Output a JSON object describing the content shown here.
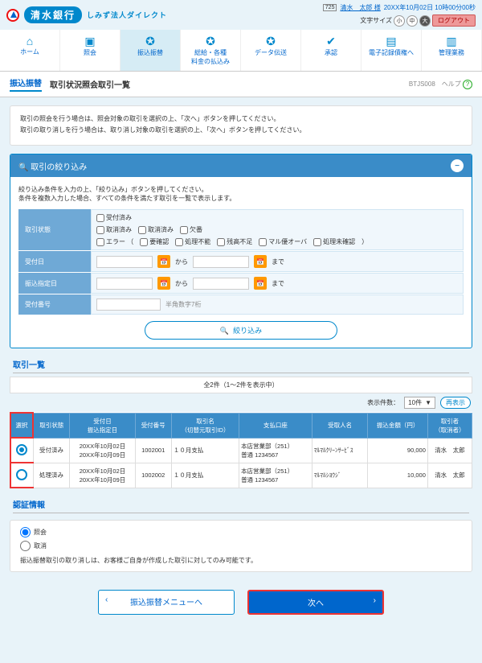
{
  "header": {
    "bank_name": "清水銀行",
    "subtitle": "しみず法人ダイレクト",
    "user_prefix": "725",
    "user_name": "清水　太郎 様",
    "datetime": "20XX年10月02日 10時00分00秒",
    "font_label": "文字サイズ",
    "font_small": "小",
    "font_med": "中",
    "font_large": "大",
    "logout": "ログアウト"
  },
  "nav": [
    {
      "icon": "⌂",
      "label": "ホーム"
    },
    {
      "icon": "▣",
      "label": "照会"
    },
    {
      "icon": "✪",
      "label": "振込振替"
    },
    {
      "icon": "✪",
      "label": "総給・各種\n料金の払込み"
    },
    {
      "icon": "✪",
      "label": "データ伝送"
    },
    {
      "icon": "✔",
      "label": "承認"
    },
    {
      "icon": "▤",
      "label": "電子記録債権へ"
    },
    {
      "icon": "▥",
      "label": "管理業務"
    }
  ],
  "crumb": {
    "category": "振込振替",
    "title": "取引状況照会取引一覧",
    "code": "BTJS008",
    "help": "ヘルプ"
  },
  "desc": {
    "l1": "取引の照会を行う場合は、照会対象の取引を選択の上、「次へ」ボタンを押してください。",
    "l2": "取引の取り消しを行う場合は、取り消し対象の取引を選択の上、「次へ」ボタンを押してください。"
  },
  "filter": {
    "title": "取引の絞り込み",
    "note1": "絞り込み条件を入力の上、「絞り込み」ボタンを押してください。",
    "note2": "条件を複数入力した場合、すべての条件を満たす取引を一覧で表示します。",
    "status_label": "取引状態",
    "statuses_row1": [
      "受付済み"
    ],
    "statuses_row2": [
      "取消済み",
      "取消済み",
      "欠番"
    ],
    "statuses_row3_pre": "エラー （",
    "statuses_row3": [
      "要確認",
      "処理不能",
      "残高不足",
      "マル優オーバ",
      "処理未確認"
    ],
    "statuses_row3_post": "）",
    "recv_date_label": "受付日",
    "send_date_label": "振込指定日",
    "from": "から",
    "to": "まで",
    "recv_no_label": "受付番号",
    "recv_no_hint": "半角数字7桁",
    "filter_btn": "絞り込み",
    "search_icon": "🔍"
  },
  "list": {
    "title": "取引一覧",
    "count_text": "全2件（1～2件を表示中）",
    "per_page_label": "表示件数：",
    "per_page_value": "10件",
    "refresh": "再表示",
    "cols": {
      "select": "選択",
      "status": "取引状態",
      "dates": "受付日\n振込指定日",
      "recv_no": "受付番号",
      "deal": "取引名\n（切替元取引ID）",
      "account": "支払口座",
      "payee": "受取人名",
      "amount": "振込金額（円）",
      "operator": "取引者\n（取消者）"
    },
    "rows": [
      {
        "selected": true,
        "status": "受付済み",
        "date1": "20XX年10月02日",
        "date2": "20XX年10月09日",
        "recv_no": "1002001",
        "deal": "１０月支払",
        "account_branch": "本店営業部（251）",
        "account_no": "普通 1234567",
        "payee": "ﾏﾙﾏﾙｸﾘｰﾝｻｰﾋﾞｽ",
        "amount": "90,000",
        "operator": "清水　太郎"
      },
      {
        "selected": false,
        "status": "処理済み",
        "date1": "20XX年10月02日",
        "date2": "20XX年10月09日",
        "recv_no": "1002002",
        "deal": "１０月支払",
        "account_branch": "本店営業部（251）",
        "account_no": "普通 1234567",
        "payee": "ﾏﾙﾏﾙｼﾖｳｼﾞ",
        "amount": "10,000",
        "operator": "清水　太郎"
      }
    ]
  },
  "auth": {
    "title": "認証情報",
    "opt1": "照会",
    "opt2": "取消",
    "note": "振込振替取引の取り消しは、お客様ご自身が作成した取引に対してのみ可能です。"
  },
  "actions": {
    "back": "振込振替メニューへ",
    "next": "次へ"
  }
}
